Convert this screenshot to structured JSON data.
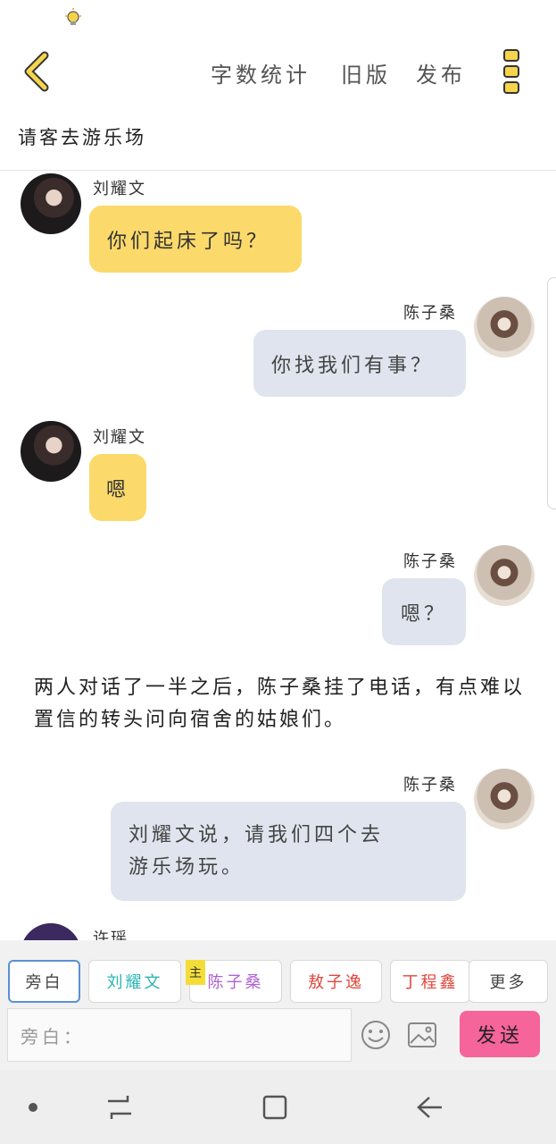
{
  "header": {
    "word_count_label": "字数统计",
    "old_version_label": "旧版",
    "publish_label": "发布"
  },
  "story_title": "请客去游乐场",
  "messages": [
    {
      "sender": "刘耀文",
      "text": "你们起床了吗？",
      "side": "left"
    },
    {
      "sender": "陈子桑",
      "text": "你找我们有事？",
      "side": "right"
    },
    {
      "sender": "刘耀文",
      "text": "嗯",
      "side": "left"
    },
    {
      "sender": "陈子桑",
      "text": "嗯？",
      "side": "right"
    },
    {
      "sender": "陈子桑",
      "text_line1": "刘耀文说，请我们四个去",
      "text_line2": "游乐场玩。",
      "side": "right"
    },
    {
      "sender": "许瑶",
      "side": "left"
    }
  ],
  "narration": "两人对话了一半之后，陈子桑挂了电话，有点难以置信的转头问向宿舍的姑娘们。",
  "roles": [
    {
      "label": "旁白",
      "color": "#444444"
    },
    {
      "label": "刘耀文",
      "color": "#2bb5b5"
    },
    {
      "label": "陈子桑",
      "color": "#b063d6",
      "tag": "主"
    },
    {
      "label": "敖子逸",
      "color": "#e0463c"
    },
    {
      "label": "丁程鑫",
      "color": "#e0463c"
    },
    {
      "label": "更多",
      "color": "#444444"
    }
  ],
  "input": {
    "placeholder": "旁白："
  },
  "send_label": "发送",
  "colors": {
    "left_bubble": "#fbd96b",
    "right_bubble": "#dfe4ee",
    "send": "#f5649a",
    "accent": "#f4dd39"
  }
}
